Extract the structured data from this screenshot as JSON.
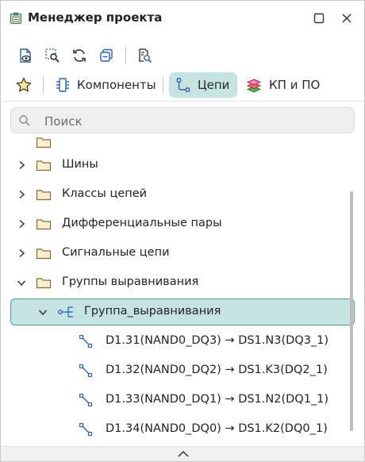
{
  "window": {
    "title": "Менеджер проекта",
    "icons": {
      "app": "project-manager-icon",
      "maximize": "maximize-icon",
      "close": "close-icon"
    }
  },
  "toolbar": {
    "buttons": [
      {
        "name": "document-view-icon"
      },
      {
        "name": "zoom-selection-icon"
      },
      {
        "name": "refresh-icon"
      },
      {
        "name": "collapse-all-icon"
      },
      {
        "name": "filter-search-icon"
      }
    ]
  },
  "tabs": [
    {
      "icon": "star-icon",
      "label": ""
    },
    {
      "icon": "component-icon",
      "label": "Компоненты"
    },
    {
      "icon": "net-icon",
      "label": "Цепи",
      "active": true
    },
    {
      "icon": "layers-icon",
      "label": "КП и ПО"
    }
  ],
  "search": {
    "placeholder": "Поиск",
    "value": ""
  },
  "tree": {
    "items": [
      {
        "label": "Шины",
        "type": "folder",
        "expanded": false
      },
      {
        "label": "Классы цепей",
        "type": "folder",
        "expanded": false
      },
      {
        "label": "Дифференциальные пары",
        "type": "folder",
        "expanded": false
      },
      {
        "label": "Сигнальные цепи",
        "type": "folder",
        "expanded": false
      },
      {
        "label": "Группы выравнивания",
        "type": "folder",
        "expanded": true
      },
      {
        "label": "Группа_выравнивания",
        "type": "group",
        "expanded": true,
        "selected": true
      },
      {
        "label": "D1.31(NAND0_DQ3) → DS1.N3(DQ3_1)",
        "type": "net"
      },
      {
        "label": "D1.32(NAND0_DQ2) → DS1.K3(DQ2_1)",
        "type": "net"
      },
      {
        "label": "D1.33(NAND0_DQ1) → DS1.N2(DQ1_1)",
        "type": "net"
      },
      {
        "label": "D1.34(NAND0_DQ0) → DS1.K2(DQ0_1)",
        "type": "net"
      }
    ]
  },
  "colors": {
    "accent": "#c4e3e1",
    "accent_border": "#4f9a97",
    "icon_blue": "#2a63b8",
    "folder_fill": "#fbefd3",
    "folder_stroke": "#8a6a2a"
  }
}
